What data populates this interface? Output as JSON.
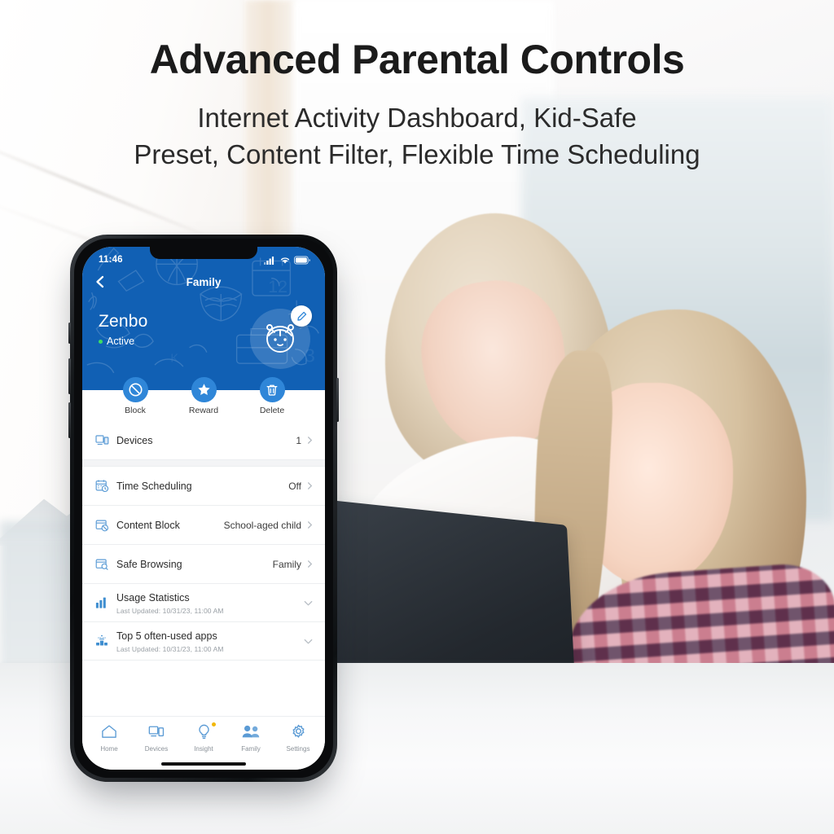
{
  "promo": {
    "headline": "Advanced Parental Controls",
    "subheadline_line1": "Internet Activity Dashboard, Kid-Safe",
    "subheadline_line2": "Preset, Content Filter, Flexible Time Scheduling"
  },
  "colors": {
    "brand_blue": "#1160b4",
    "action_blue": "#2f86d8",
    "icon_blue": "#4a90d9",
    "active_green": "#3ddc63",
    "notification_yellow": "#f2b705",
    "page_background": "#f4f3f2"
  },
  "phone": {
    "status_bar": {
      "time": "11:46",
      "icons": [
        "cellular-signal-icon",
        "wifi-icon",
        "battery-icon"
      ]
    },
    "nav_bar": {
      "back_icon": "back-chevron-icon",
      "title": "Family"
    },
    "profile": {
      "name": "Zenbo",
      "status": "Active",
      "avatar_icon": "child-avatar-icon",
      "edit_icon": "pencil-edit-icon"
    },
    "actions": [
      {
        "label": "Block",
        "icon": "block-icon"
      },
      {
        "label": "Reward",
        "icon": "star-icon"
      },
      {
        "label": "Delete",
        "icon": "trash-icon"
      }
    ],
    "list": [
      {
        "label": "Devices",
        "value": "1",
        "icon": "devices-icon",
        "accessory": "chevron-right-icon",
        "sublabel": ""
      },
      {
        "label": "Time Scheduling",
        "value": "Off",
        "icon": "calendar-clock-icon",
        "accessory": "chevron-right-icon",
        "sublabel": ""
      },
      {
        "label": "Content Block",
        "value": "School-aged child",
        "icon": "content-block-icon",
        "accessory": "chevron-right-icon",
        "sublabel": ""
      },
      {
        "label": "Safe Browsing",
        "value": "Family",
        "icon": "safe-browsing-icon",
        "accessory": "chevron-right-icon",
        "sublabel": ""
      },
      {
        "label": "Usage Statistics",
        "value": "",
        "icon": "bar-chart-icon",
        "accessory": "chevron-down-icon",
        "sublabel": "Last Updated: 10/31/23, 11:00 AM"
      },
      {
        "label": "Top 5 often-used apps",
        "value": "",
        "icon": "top-apps-icon",
        "accessory": "chevron-down-icon",
        "sublabel": "Last Updated: 10/31/23, 11:00 AM"
      }
    ],
    "tabs": [
      {
        "label": "Home",
        "icon": "home-icon",
        "active": false,
        "badge": false
      },
      {
        "label": "Devices",
        "icon": "devices-icon",
        "active": false,
        "badge": false
      },
      {
        "label": "Insight",
        "icon": "lightbulb-icon",
        "active": false,
        "badge": true
      },
      {
        "label": "Family",
        "icon": "family-icon",
        "active": true,
        "badge": false
      },
      {
        "label": "Settings",
        "icon": "gear-icon",
        "active": false,
        "badge": false
      }
    ]
  }
}
